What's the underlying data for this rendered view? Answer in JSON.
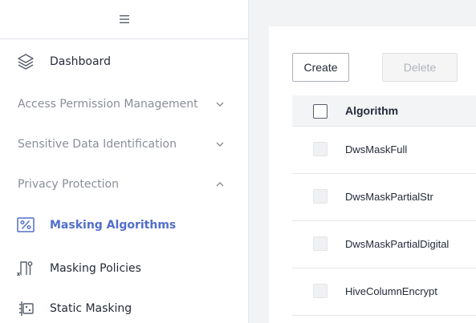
{
  "sidebar": {
    "dashboard": {
      "label": "Dashboard",
      "icon": "layers-icon"
    },
    "groups": [
      {
        "label": "Access Permission Management",
        "expanded": false
      },
      {
        "label": "Sensitive Data Identification",
        "expanded": false
      },
      {
        "label": "Privacy Protection",
        "expanded": true
      }
    ],
    "sub_items": [
      {
        "label": "Masking Algorithms",
        "icon": "percent-icon",
        "active": true
      },
      {
        "label": "Masking Policies",
        "icon": "masking-policy-icon",
        "active": false
      },
      {
        "label": "Static Masking",
        "icon": "static-masking-icon",
        "active": false
      }
    ]
  },
  "toolbar": {
    "create_label": "Create",
    "delete_label": "Delete"
  },
  "table": {
    "columns": [
      "Algorithm"
    ],
    "rows": [
      {
        "algorithm": "DwsMaskFull"
      },
      {
        "algorithm": "DwsMaskPartialStr"
      },
      {
        "algorithm": "DwsMaskPartialDigital"
      },
      {
        "algorithm": "HiveColumnEncrypt"
      }
    ]
  },
  "colors": {
    "accent": "#526ecc",
    "text": "#252b3a",
    "muted": "#8a8e99"
  }
}
